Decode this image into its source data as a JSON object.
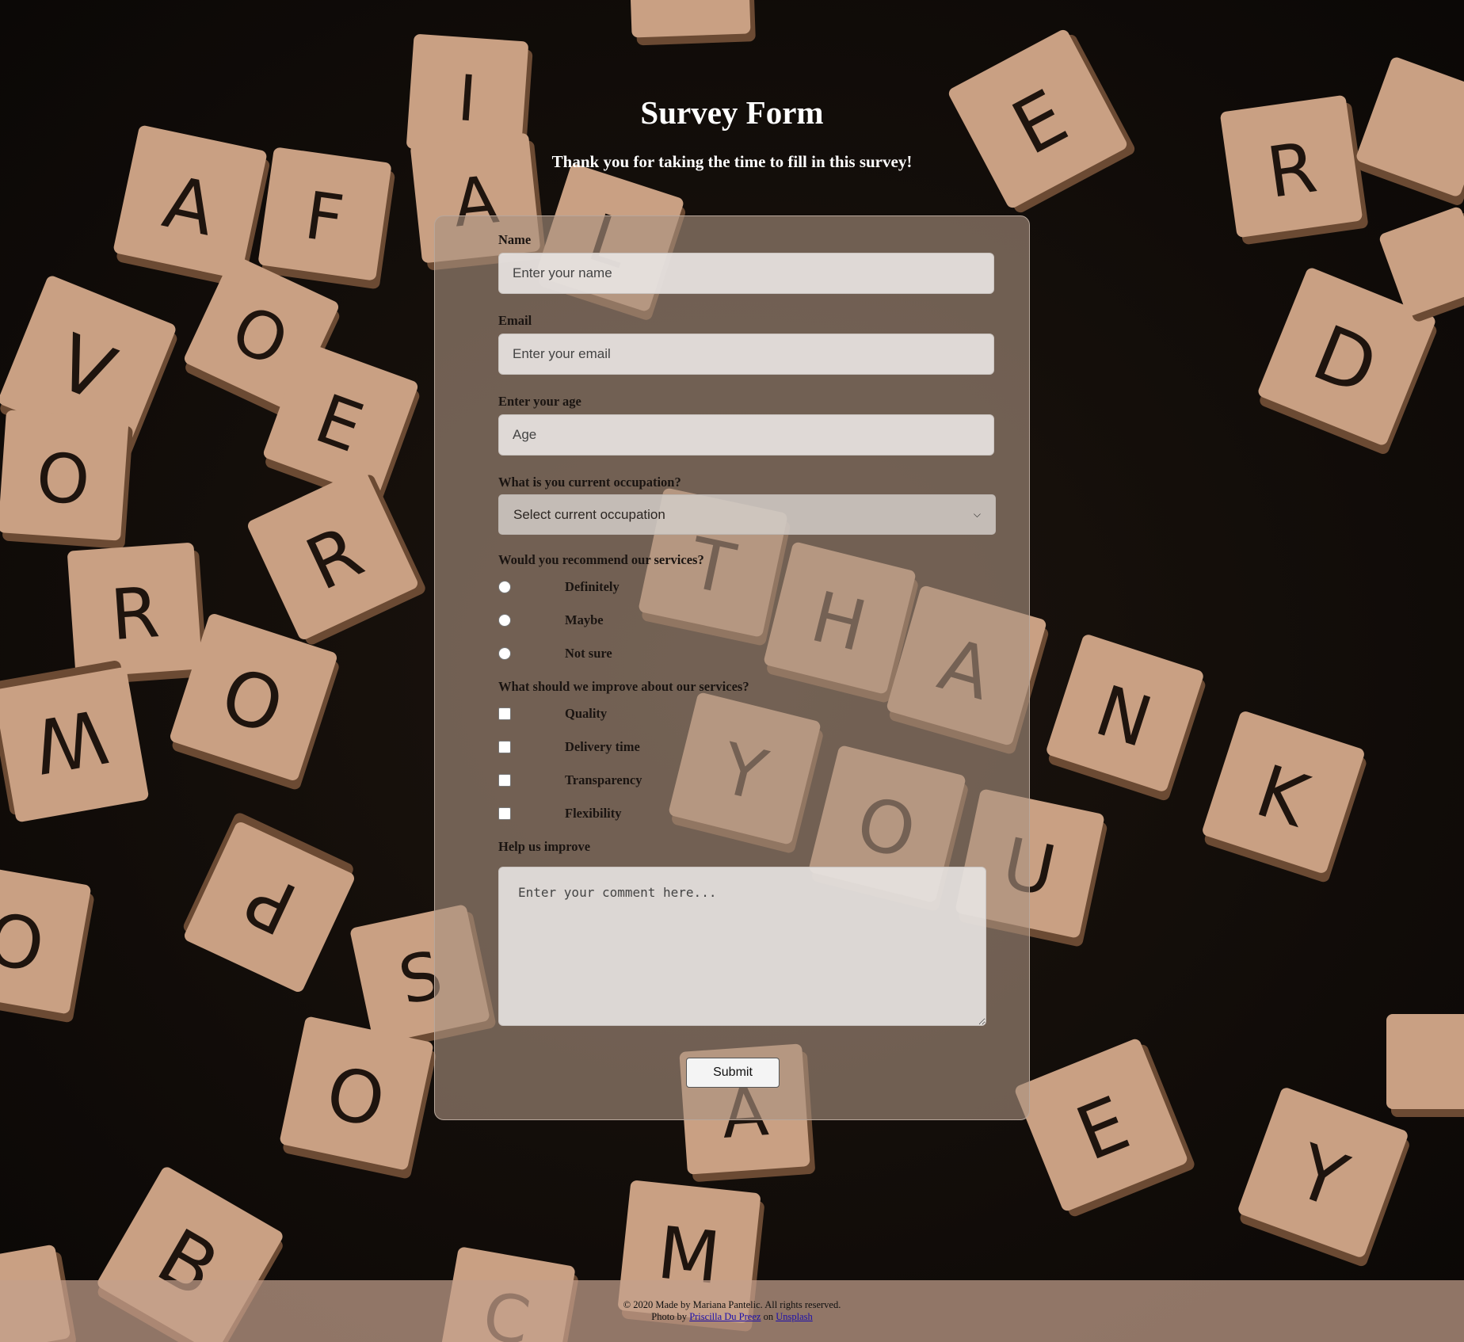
{
  "header": {
    "title": "Survey Form",
    "subtitle": "Thank you for taking the time to fill in this survey!"
  },
  "form": {
    "name_label": "Name",
    "name_placeholder": "Enter your name",
    "email_label": "Email",
    "email_placeholder": "Enter your email",
    "age_label": "Enter your age",
    "age_placeholder": "Age",
    "occupation_label": "What is you current occupation?",
    "occupation_selected": "Select current occupation",
    "recommend_label": "Would you recommend our services?",
    "recommend_options": [
      "Definitely",
      "Maybe",
      "Not sure"
    ],
    "improve_label": "What should we improve about our services?",
    "improve_options": [
      "Quality",
      "Delivery time",
      "Transparency",
      "Flexibility"
    ],
    "help_label": "Help us improve",
    "comment_placeholder": "Enter your comment here...",
    "submit_label": "Submit"
  },
  "footer": {
    "copyright": "© 2020 Made by Mariana Pantelic. All rights reserved.",
    "photo_prefix": "Photo by",
    "photographer": "Priscilla Du Preez",
    "photo_on": "on",
    "source": "Unsplash"
  },
  "colors": {
    "background": "#120d09",
    "card": "#8a7565",
    "footer": "#c3a08c",
    "link": "#1a0dab"
  }
}
